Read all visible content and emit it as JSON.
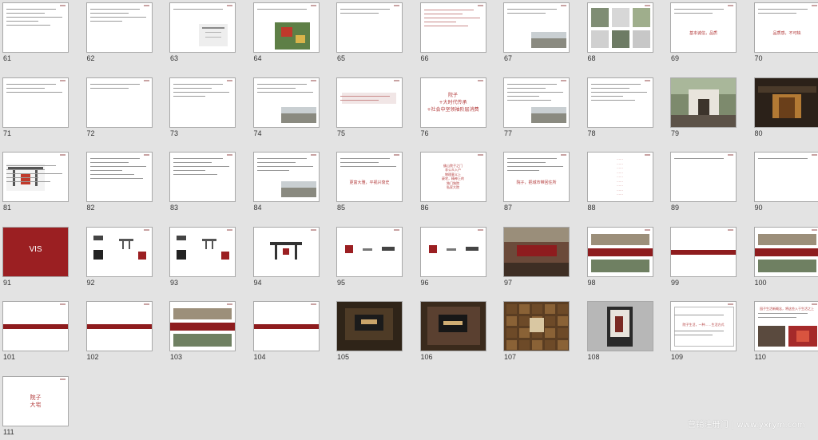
{
  "watermark": "营销注册门 | www.yxrym.com",
  "slides": [
    {
      "number": "61",
      "kind": "text",
      "lines": 5
    },
    {
      "number": "62",
      "kind": "text",
      "lines": 4
    },
    {
      "number": "63",
      "kind": "text-image",
      "lines": 1
    },
    {
      "number": "64",
      "kind": "map",
      "lines": 1
    },
    {
      "number": "65",
      "kind": "text",
      "lines": 2
    },
    {
      "number": "66",
      "kind": "list",
      "lines": 5
    },
    {
      "number": "67",
      "kind": "text-photo",
      "lines": 2
    },
    {
      "number": "68",
      "kind": "collage"
    },
    {
      "number": "69",
      "kind": "text-red",
      "lines": 2,
      "red_text": "基本诚信，品质"
    },
    {
      "number": "70",
      "kind": "text-red",
      "lines": 2,
      "red_text": "品质感，不可缺"
    },
    {
      "number": "71",
      "kind": "text",
      "lines": 3
    },
    {
      "number": "72",
      "kind": "text",
      "lines": 2
    },
    {
      "number": "73",
      "kind": "text",
      "lines": 4
    },
    {
      "number": "74",
      "kind": "text-photo",
      "lines": 3
    },
    {
      "number": "75",
      "kind": "band-text"
    },
    {
      "number": "76",
      "kind": "center-red",
      "red_lines": [
        "院子",
        "+大时代传承",
        "+社会中坚领袖阶层消费"
      ]
    },
    {
      "number": "77",
      "kind": "text-photo",
      "lines": 5
    },
    {
      "number": "78",
      "kind": "text",
      "lines": 5
    },
    {
      "number": "79",
      "kind": "photo-gate"
    },
    {
      "number": "80",
      "kind": "photo-dark"
    },
    {
      "number": "81",
      "kind": "diagram"
    },
    {
      "number": "82",
      "kind": "text",
      "lines": 6
    },
    {
      "number": "83",
      "kind": "text",
      "lines": 5
    },
    {
      "number": "84",
      "kind": "text-photo",
      "lines": 4
    },
    {
      "number": "85",
      "kind": "text-red",
      "lines": 3,
      "red_text": "更富大雅，平视兴衰史"
    },
    {
      "number": "86",
      "kind": "center-red",
      "red_lines": [
        "佛山院子之门",
        "非公众入户",
        "物理意义上",
        "豪宅，精神上的",
        "独门独院",
        "私家大院"
      ]
    },
    {
      "number": "87",
      "kind": "text-red",
      "lines": 4,
      "red_text": "院子，把城市带回住所"
    },
    {
      "number": "88",
      "kind": "center-red",
      "red_lines": [
        "……",
        "……",
        "……",
        "……",
        "……",
        "……",
        "……",
        "……",
        "……"
      ]
    },
    {
      "number": "89",
      "kind": "text",
      "lines": 1
    },
    {
      "number": "90",
      "kind": "text",
      "lines": 1
    },
    {
      "number": "91",
      "kind": "vis",
      "title": "VIS"
    },
    {
      "number": "92",
      "kind": "logo-set"
    },
    {
      "number": "93",
      "kind": "logo-set"
    },
    {
      "number": "94",
      "kind": "logo-center"
    },
    {
      "number": "95",
      "kind": "logo-trio"
    },
    {
      "number": "96",
      "kind": "logo-trio"
    },
    {
      "number": "97",
      "kind": "photo-banner"
    },
    {
      "number": "98",
      "kind": "banner-stack"
    },
    {
      "number": "99",
      "kind": "banner-thin"
    },
    {
      "number": "100",
      "kind": "banner-stack"
    },
    {
      "number": "101",
      "kind": "banner-thin"
    },
    {
      "number": "102",
      "kind": "banner-thin"
    },
    {
      "number": "103",
      "kind": "banner-stack"
    },
    {
      "number": "104",
      "kind": "banner-thin"
    },
    {
      "number": "105",
      "kind": "photo-lobby"
    },
    {
      "number": "106",
      "kind": "photo-lobby2"
    },
    {
      "number": "107",
      "kind": "photo-wall"
    },
    {
      "number": "108",
      "kind": "photo-kiosk"
    },
    {
      "number": "109",
      "kind": "framed",
      "red_text": "院子生活，一种……生活方式"
    },
    {
      "number": "110",
      "kind": "text-photos",
      "red_text": "园子生活新概念，将这些入于生活之上"
    },
    {
      "number": "111",
      "kind": "center-red",
      "red_lines": [
        "院子",
        "大宅"
      ]
    }
  ]
}
